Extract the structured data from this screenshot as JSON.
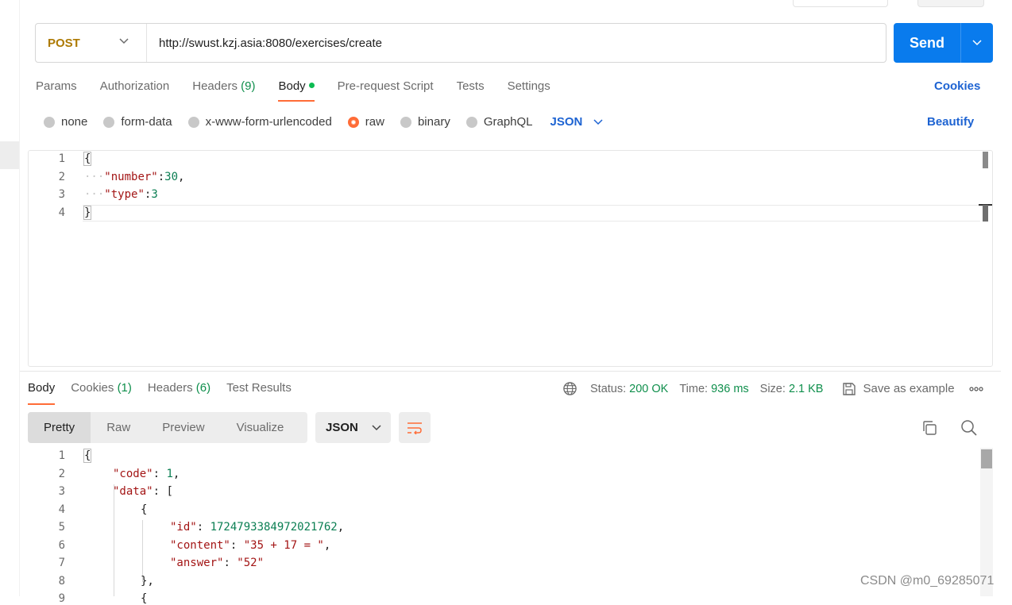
{
  "request": {
    "method": "POST",
    "url": "http://swust.kzj.asia:8080/exercises/create",
    "send_label": "Send"
  },
  "request_tabs": [
    {
      "label": "Params",
      "count": ""
    },
    {
      "label": "Authorization",
      "count": ""
    },
    {
      "label": "Headers ",
      "count": "(9)"
    },
    {
      "label": "Body",
      "count": ""
    },
    {
      "label": "Pre-request Script",
      "count": ""
    },
    {
      "label": "Tests",
      "count": ""
    },
    {
      "label": "Settings",
      "count": ""
    }
  ],
  "cookies_link": "Cookies",
  "body_types": [
    "none",
    "form-data",
    "x-www-form-urlencoded",
    "raw",
    "binary",
    "GraphQL"
  ],
  "raw_format": "JSON",
  "beautify_link": "Beautify",
  "request_body": {
    "line_numbers": [
      "1",
      "2",
      "3",
      "4"
    ],
    "open_brace": "{",
    "close_brace": "}",
    "lines": [
      {
        "indent": "···",
        "key": "\"number\"",
        "sep": ":",
        "value": "30",
        "end": ","
      },
      {
        "indent": "···",
        "key": "\"type\"",
        "sep": ":",
        "value": "3",
        "end": ""
      }
    ]
  },
  "response_tabs": [
    {
      "label": "Body",
      "count": ""
    },
    {
      "label": "Cookies ",
      "count": "(1)"
    },
    {
      "label": "Headers ",
      "count": "(6)"
    },
    {
      "label": "Test Results",
      "count": ""
    }
  ],
  "response_meta": {
    "status_label": "Status:",
    "status_value": "200 OK",
    "time_label": "Time:",
    "time_value": "936 ms",
    "size_label": "Size:",
    "size_value": "2.1 KB",
    "save_example": "Save as example"
  },
  "view_modes": [
    "Pretty",
    "Raw",
    "Preview",
    "Visualize"
  ],
  "response_format": "JSON",
  "response_body": {
    "line_numbers": [
      "1",
      "2",
      "3",
      "4",
      "5",
      "6",
      "7",
      "8",
      "9"
    ],
    "l1": "{",
    "l2_key": "\"code\"",
    "l2_val": "1",
    "l3_key": "\"data\"",
    "l3_val": "[",
    "l4": "{",
    "l5_key": "\"id\"",
    "l5_val": "1724793384972021762",
    "l6_key": "\"content\"",
    "l6_val": "\"35 + 17 = \"",
    "l7_key": "\"answer\"",
    "l7_val": "\"52\"",
    "l8": "},",
    "l9": "{"
  },
  "watermark": "CSDN @m0_69285071",
  "icons": [
    "chevron-down-icon",
    "globe-icon",
    "save-icon",
    "more-icon",
    "wrap-lines-icon",
    "copy-icon",
    "search-icon"
  ],
  "colors": {
    "accent": "#ff6c37",
    "send": "#097bed",
    "link": "#1d63d2",
    "success": "#0f8f4c",
    "method": "#ad7a03"
  }
}
